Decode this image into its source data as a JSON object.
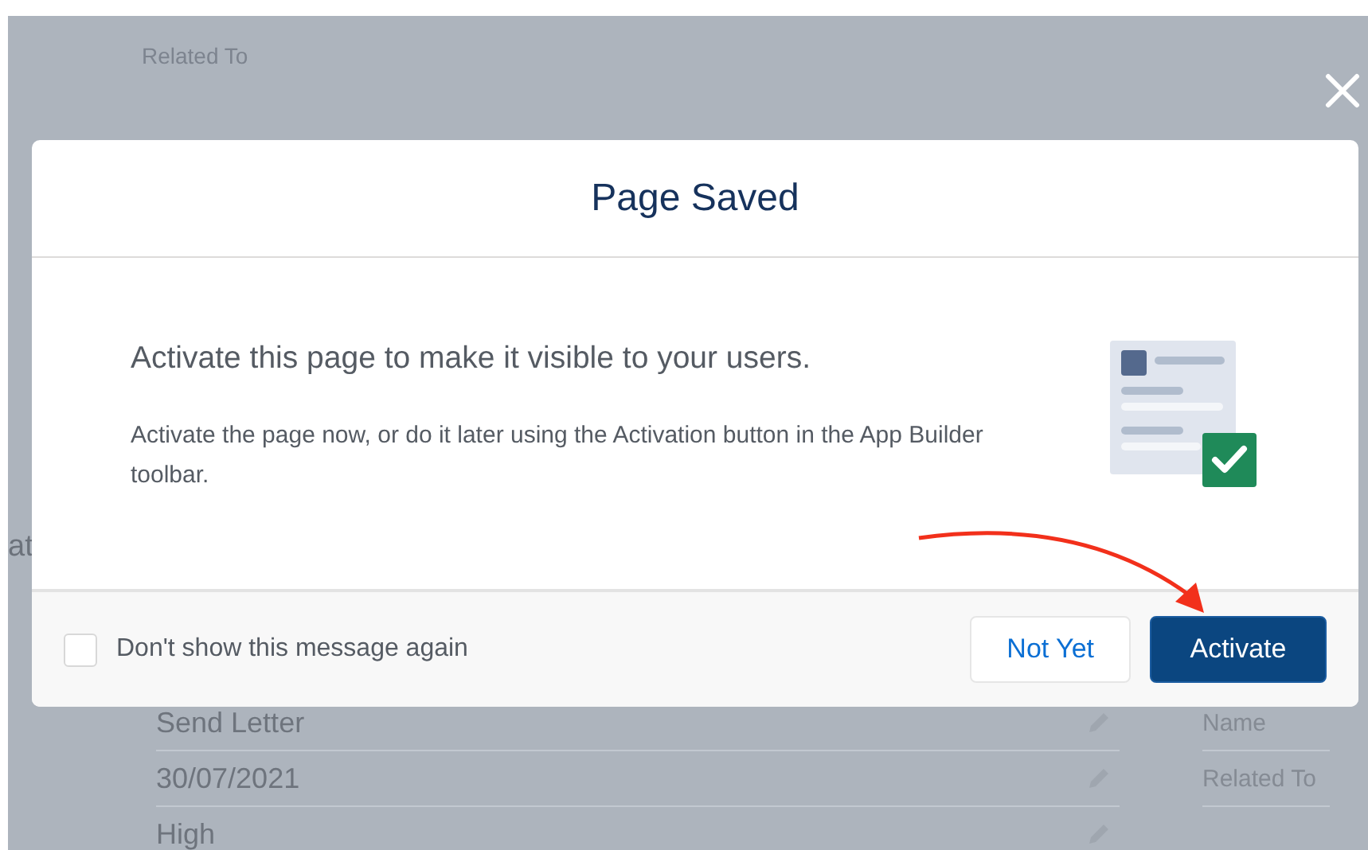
{
  "background": {
    "top_label": "Related To",
    "side_fragment": "at",
    "rows": [
      {
        "value": "Send Letter",
        "label": "Name"
      },
      {
        "value": "30/07/2021",
        "label": "Related To"
      },
      {
        "value": "High"
      }
    ]
  },
  "modal": {
    "title": "Page Saved",
    "heading": "Activate this page to make it visible to your users.",
    "body": "Activate the page now, or do it later using the Activation button in the App Builder toolbar.",
    "checkbox": {
      "label": "Don't show this message again",
      "checked": false
    },
    "buttons": [
      {
        "label": "Not Yet",
        "kind": "neutral"
      },
      {
        "label": "Activate",
        "kind": "brand"
      }
    ]
  }
}
